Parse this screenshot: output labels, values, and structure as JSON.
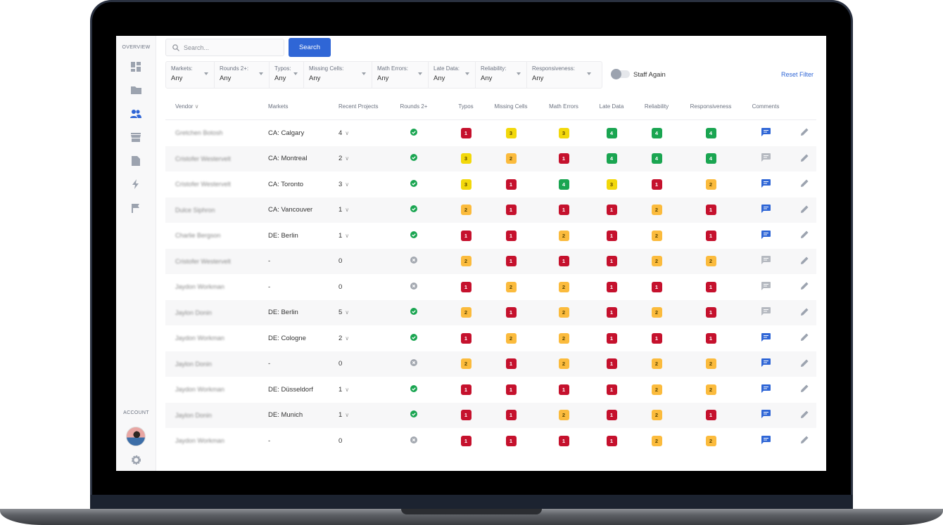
{
  "sidebar": {
    "overview_label": "OVERVIEW",
    "account_label": "ACCOUNT",
    "items": [
      "dashboard",
      "projects",
      "vendors",
      "store",
      "documents",
      "activity",
      "flags"
    ]
  },
  "search": {
    "placeholder": "Search...",
    "button": "Search"
  },
  "filters": [
    {
      "label": "Markets:",
      "value": "Any"
    },
    {
      "label": "Rounds 2+:",
      "value": "Any"
    },
    {
      "label": "Typos:",
      "value": "Any"
    },
    {
      "label": "Missing Cells:",
      "value": "Any"
    },
    {
      "label": "Math Errors:",
      "value": "Any"
    },
    {
      "label": "Late Data:",
      "value": "Any"
    },
    {
      "label": "Reliability:",
      "value": "Any"
    },
    {
      "label": "Responsiveness:",
      "value": "Any"
    }
  ],
  "toggle": {
    "label": "Staff Again",
    "on": false
  },
  "reset_label": "Reset Filter",
  "columns": [
    "Vendor",
    "Markets",
    "Recent Projects",
    "Rounds 2+",
    "Typos",
    "Missing Cells",
    "Math Errors",
    "Late Data",
    "Reliability",
    "Responsiveness",
    "Comments"
  ],
  "colors": {
    "1": "#c5112d",
    "2": "#fbbb3d",
    "3": "#f2d80b",
    "4": "#1aa551",
    "accent": "#2f66d6",
    "check": "#1aa551",
    "x": "#a3a8b0"
  },
  "rows": [
    {
      "vendor": "Gretchen Botosh",
      "market": "CA: Calgary",
      "recent": "4",
      "rounds": true,
      "scores": [
        1,
        3,
        3,
        4,
        4,
        4
      ],
      "comment": true
    },
    {
      "vendor": "Cristofer Westervelt",
      "market": "CA: Montreal",
      "recent": "2",
      "rounds": true,
      "scores": [
        3,
        2,
        1,
        4,
        4,
        4
      ],
      "comment": false
    },
    {
      "vendor": "Cristofer Westervelt",
      "market": "CA: Toronto",
      "recent": "3",
      "rounds": true,
      "scores": [
        3,
        1,
        4,
        3,
        1,
        2
      ],
      "comment": true
    },
    {
      "vendor": "Dulce Siphron",
      "market": "CA: Vancouver",
      "recent": "1",
      "rounds": true,
      "scores": [
        2,
        1,
        1,
        1,
        2,
        1
      ],
      "comment": true
    },
    {
      "vendor": "Charlie Bergson",
      "market": "DE: Berlin",
      "recent": "1",
      "rounds": true,
      "scores": [
        1,
        1,
        2,
        1,
        2,
        1
      ],
      "comment": true
    },
    {
      "vendor": "Cristofer Westervelt",
      "market": "-",
      "recent": "0",
      "rounds": false,
      "scores": [
        2,
        1,
        1,
        1,
        2,
        2
      ],
      "comment": false
    },
    {
      "vendor": "Jaydon Workman",
      "market": "-",
      "recent": "0",
      "rounds": false,
      "scores": [
        1,
        2,
        2,
        1,
        1,
        1
      ],
      "comment": false
    },
    {
      "vendor": "Jaylon Donin",
      "market": "DE: Berlin",
      "recent": "5",
      "rounds": true,
      "scores": [
        2,
        1,
        2,
        1,
        2,
        1
      ],
      "comment": false
    },
    {
      "vendor": "Jaydon Workman",
      "market": "DE: Cologne",
      "recent": "2",
      "rounds": true,
      "scores": [
        1,
        2,
        2,
        1,
        1,
        1
      ],
      "comment": true
    },
    {
      "vendor": "Jaylon Donin",
      "market": "-",
      "recent": "0",
      "rounds": false,
      "scores": [
        2,
        1,
        2,
        1,
        2,
        2
      ],
      "comment": true
    },
    {
      "vendor": "Jaydon Workman",
      "market": "DE: Düsseldorf",
      "recent": "1",
      "rounds": true,
      "scores": [
        1,
        1,
        1,
        1,
        2,
        2
      ],
      "comment": true
    },
    {
      "vendor": "Jaylon Donin",
      "market": "DE: Munich",
      "recent": "1",
      "rounds": true,
      "scores": [
        1,
        1,
        2,
        1,
        2,
        1
      ],
      "comment": true
    },
    {
      "vendor": "Jaydon Workman",
      "market": "-",
      "recent": "0",
      "rounds": false,
      "scores": [
        1,
        1,
        1,
        1,
        2,
        2
      ],
      "comment": true
    }
  ]
}
